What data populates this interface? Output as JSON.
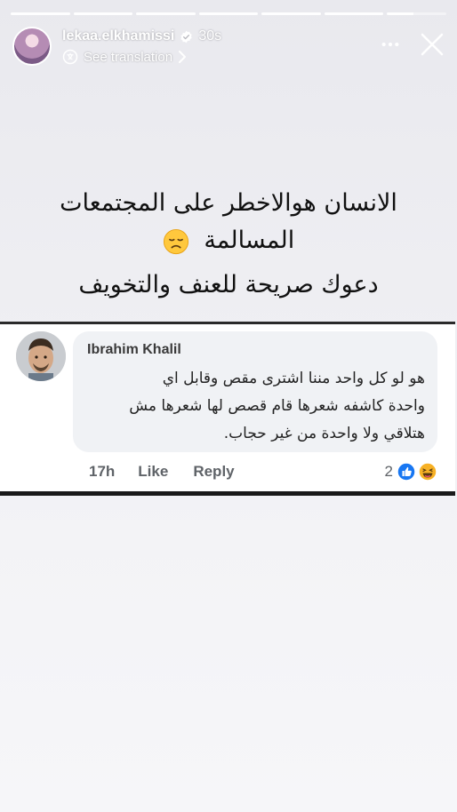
{
  "story": {
    "username": "lekaa.elkhamissi",
    "time": "30s",
    "translate_label": "See translation",
    "progress_segments": 7
  },
  "caption": {
    "line1": "الانسان هوالاخطر على المجتمعات",
    "line2": "المسالمة",
    "line2_emoji": "disappointed-face-icon",
    "line3": "دعوك صريحة للعنف والتخويف"
  },
  "comment": {
    "author": "Ibrahim Khalil",
    "text_lines": [
      "هو لو كل واحد مننا اشترى مقص وقابل اي",
      "واحدة كاشفه شعرها قام قصص لها شعرها مش",
      "هتلاقي ولا واحدة من غير حجاب."
    ],
    "time": "17h",
    "like_label": "Like",
    "reply_label": "Reply",
    "reaction_count": "2",
    "reaction_icons": [
      "like-reaction-icon",
      "haha-reaction-icon"
    ]
  },
  "colors": {
    "background": "#efeff3",
    "bubble": "#f0f2f5",
    "verified": "#ffffff",
    "like_blue": "#1877f2",
    "haha_yellow": "#f7b125"
  }
}
